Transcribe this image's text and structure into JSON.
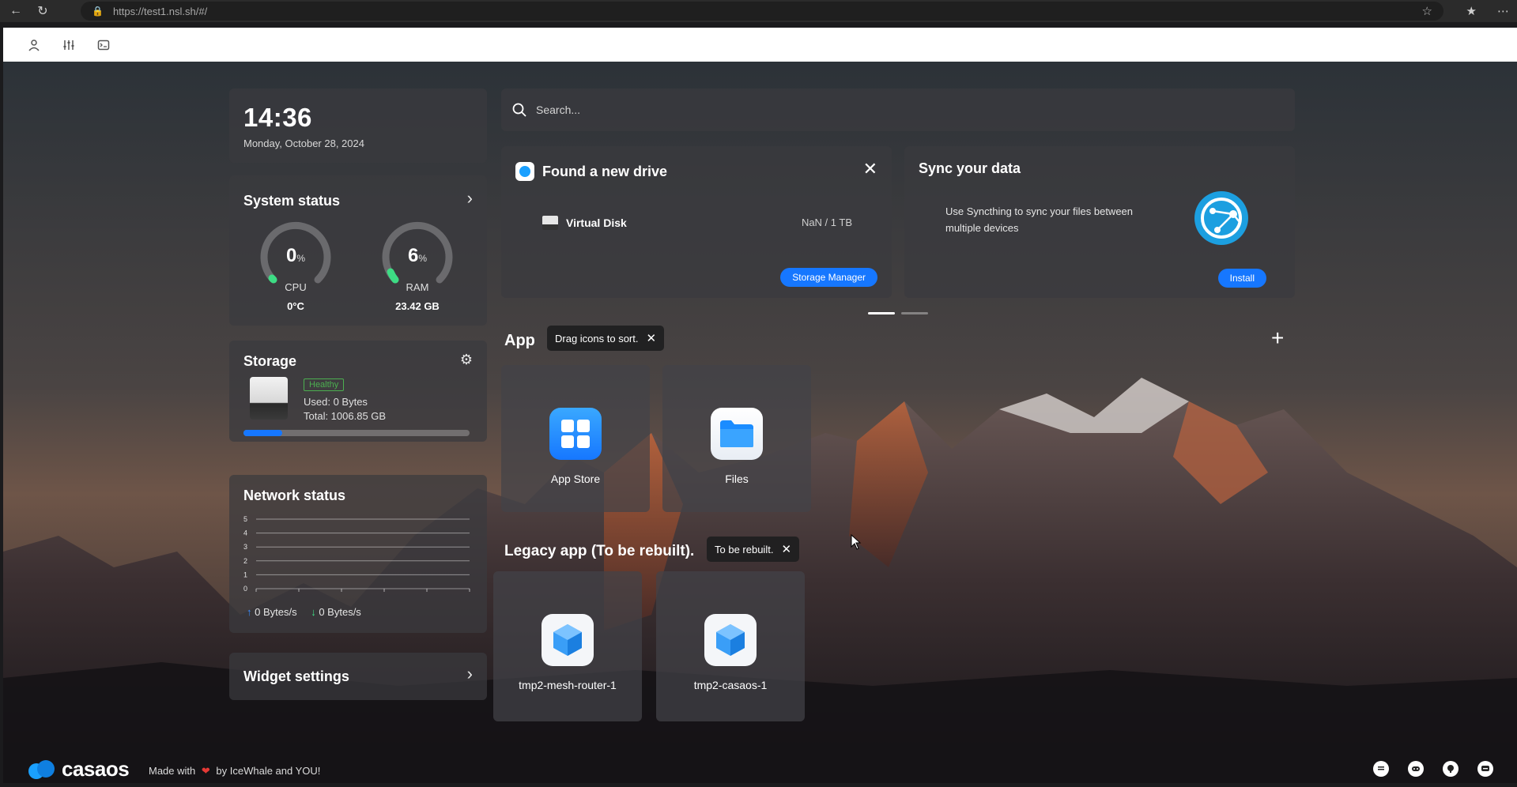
{
  "browser": {
    "url": "https://test1.nsl.sh/#/"
  },
  "clock": {
    "time": "14:36",
    "date": "Monday, October 28, 2024"
  },
  "system_status": {
    "title": "System status",
    "cpu": {
      "value": "0",
      "unit": "%",
      "label": "CPU",
      "sub": "0°C",
      "percent": 0
    },
    "ram": {
      "value": "6",
      "unit": "%",
      "label": "RAM",
      "sub": "23.42 GB",
      "percent": 6
    }
  },
  "storage": {
    "title": "Storage",
    "badge": "Healthy",
    "used": "Used: 0 Bytes",
    "total": "Total: 1006.85 GB",
    "usage_fraction": 0.17
  },
  "network": {
    "title": "Network status",
    "y_ticks": [
      "5",
      "4",
      "3",
      "2",
      "1",
      "0"
    ],
    "upload": "0 Bytes/s",
    "download": "0 Bytes/s"
  },
  "widget_settings": {
    "title": "Widget settings"
  },
  "search": {
    "placeholder": "Search..."
  },
  "new_drive": {
    "title": "Found a new drive",
    "drive_name": "Virtual Disk",
    "drive_size": "NaN / 1 TB",
    "button": "Storage Manager"
  },
  "sync": {
    "title": "Sync your data",
    "description": "Use Syncthing to sync your files between multiple devices",
    "button": "Install"
  },
  "apps": {
    "title": "App",
    "tooltip": "Drag icons to sort.",
    "items": [
      {
        "name": "App Store"
      },
      {
        "name": "Files"
      }
    ]
  },
  "legacy_apps": {
    "title": "Legacy app (To be rebuilt).",
    "tooltip": "To be rebuilt.",
    "items": [
      {
        "name": "tmp2-mesh-router-1"
      },
      {
        "name": "tmp2-casaos-1"
      }
    ]
  },
  "footer": {
    "brand": "casaos",
    "made_with": "Made with",
    "by": "by IceWhale and YOU!"
  },
  "colors": {
    "accent": "#1677ff",
    "healthy": "#4caf50",
    "gauge_active": "#3ddc84",
    "heart": "#e53935"
  }
}
